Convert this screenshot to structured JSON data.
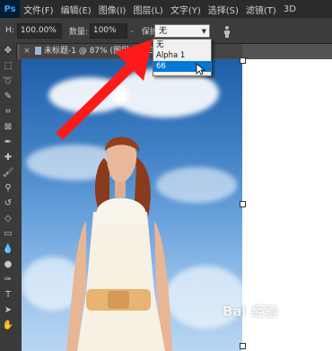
{
  "app": {
    "logo": "Ps"
  },
  "menubar": {
    "items": [
      "文件(F)",
      "编辑(E)",
      "图像(I)",
      "图层(L)",
      "文字(Y)",
      "选择(S)",
      "滤镜(T)",
      "3D"
    ]
  },
  "options": {
    "h_label": "H:",
    "h_value": "100.00%",
    "amount_label": "数量:",
    "amount_value": "100%",
    "protect_label": "保护:",
    "protect_value": "无"
  },
  "dropdown": {
    "options": [
      "无",
      "Alpha 1",
      "66"
    ],
    "selected_index": 2
  },
  "document": {
    "tab_title": "未标题-1 @ 87% (图层 1, RGB/8)"
  },
  "watermark": {
    "text": "Bai 经验"
  },
  "colors": {
    "accent": "#ff1a1a",
    "selection": "#0078d7",
    "sky": "#3f7fc5"
  }
}
